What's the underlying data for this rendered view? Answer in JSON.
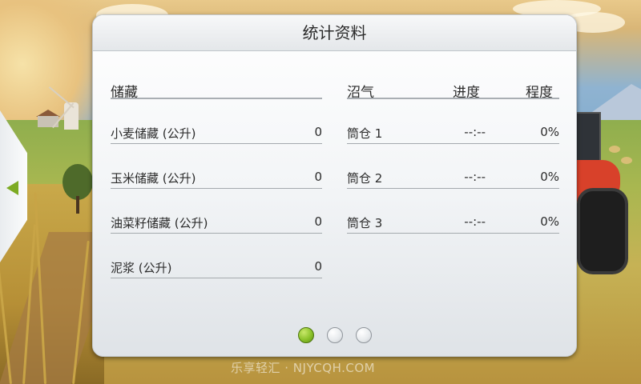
{
  "panel": {
    "title": "统计资料"
  },
  "storage": {
    "header": "储藏",
    "rows": [
      {
        "label": "小麦储藏 (公升)",
        "value": "0"
      },
      {
        "label": "玉米储藏 (公升)",
        "value": "0"
      },
      {
        "label": "油菜籽储藏 (公升)",
        "value": "0"
      },
      {
        "label": "泥浆 (公升)",
        "value": "0"
      }
    ]
  },
  "biogas": {
    "header": "沼气",
    "progress_header": "进度",
    "level_header": "程度",
    "rows": [
      {
        "label": "筒仓 1",
        "progress": "--:--",
        "level": "0%"
      },
      {
        "label": "筒仓 2",
        "progress": "--:--",
        "level": "0%"
      },
      {
        "label": "筒仓 3",
        "progress": "--:--",
        "level": "0%"
      }
    ]
  },
  "pagination": {
    "pages": 3,
    "active_page": 1
  },
  "colors": {
    "accent_green": "#8bc22a",
    "panel_bg": "#f3f5f7",
    "tractor_red": "#d8412a"
  },
  "icons": {
    "side_tab": "triangle-left-icon"
  },
  "watermark": "乐享轻汇 · NJYCQH.COM"
}
